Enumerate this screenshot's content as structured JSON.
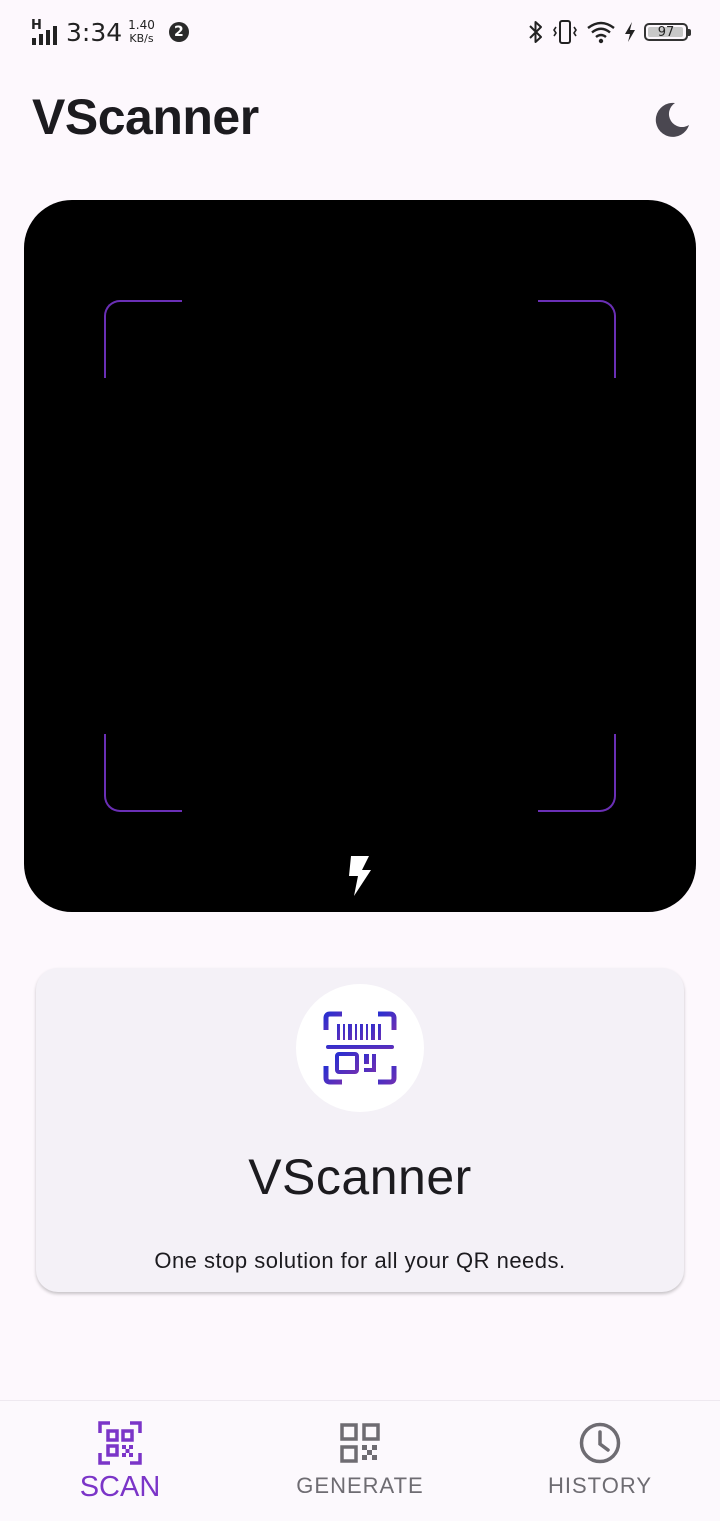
{
  "status_bar": {
    "network": "H",
    "time": "3:34",
    "speed_value": "1.40",
    "speed_unit": "KB/s",
    "notification_count": "2",
    "battery_percent": 97
  },
  "header": {
    "title": "VScanner",
    "theme_toggle_icon": "moon-icon"
  },
  "scanner": {
    "frame_color": "#6a2fb5",
    "flash_icon": "flash-icon"
  },
  "info_card": {
    "logo_icon": "barcode-scanner-icon",
    "title": "VScanner",
    "subtitle": "One stop solution for all your QR needs."
  },
  "bottom_nav": {
    "items": [
      {
        "label": "SCAN",
        "icon": "qr-scan-icon",
        "active": true
      },
      {
        "label": "GENERATE",
        "icon": "qr-code-icon",
        "active": false
      },
      {
        "label": "HISTORY",
        "icon": "clock-icon",
        "active": false
      }
    ]
  },
  "colors": {
    "accent": "#7b35c8",
    "background": "#fdf8fd",
    "card": "#f4f1f7"
  }
}
